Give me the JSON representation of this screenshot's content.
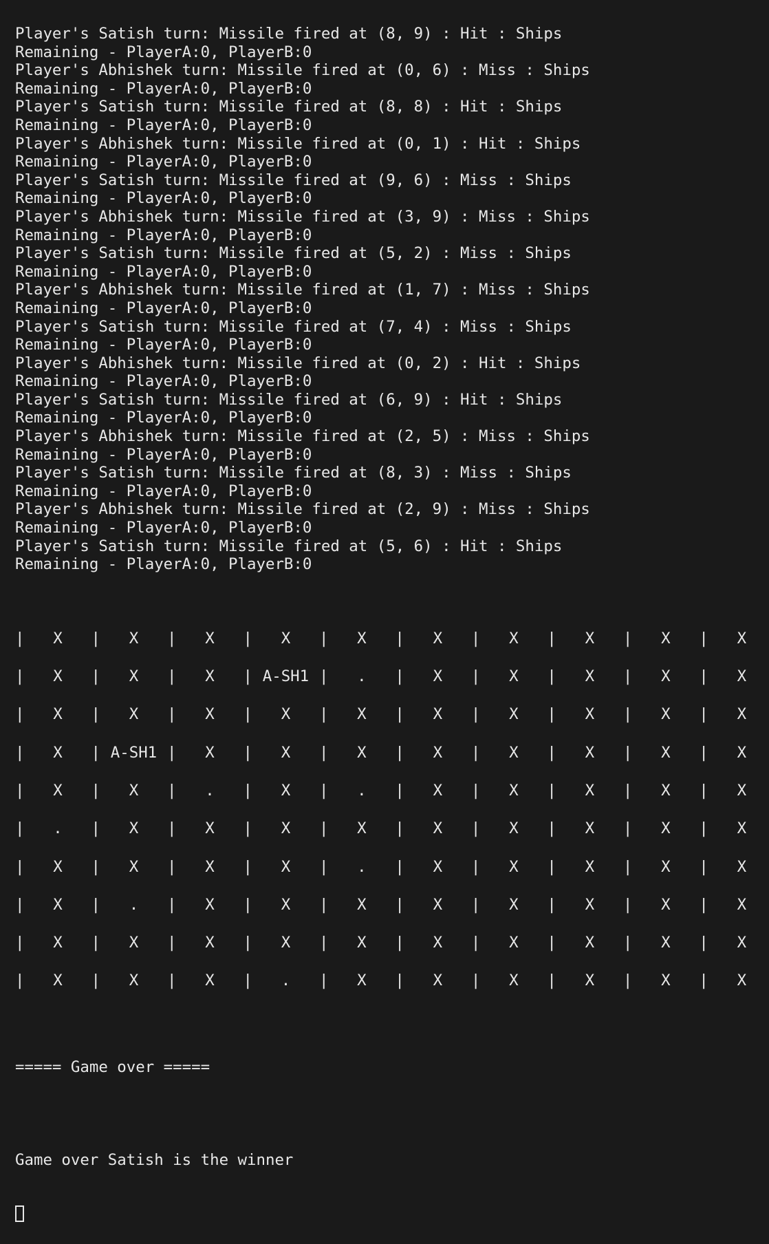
{
  "terminal": {
    "log_lines": [
      "Player's Satish turn: Missile fired at (8, 9) : Hit : Ships",
      "Remaining - PlayerA:0, PlayerB:0",
      "Player's Abhishek turn: Missile fired at (0, 6) : Miss : Ships",
      "Remaining - PlayerA:0, PlayerB:0",
      "Player's Satish turn: Missile fired at (8, 8) : Hit : Ships",
      "Remaining - PlayerA:0, PlayerB:0",
      "Player's Abhishek turn: Missile fired at (0, 1) : Hit : Ships",
      "Remaining - PlayerA:0, PlayerB:0",
      "Player's Satish turn: Missile fired at (9, 6) : Miss : Ships",
      "Remaining - PlayerA:0, PlayerB:0",
      "Player's Abhishek turn: Missile fired at (3, 9) : Miss : Ships",
      "Remaining - PlayerA:0, PlayerB:0",
      "Player's Satish turn: Missile fired at (5, 2) : Miss : Ships",
      "Remaining - PlayerA:0, PlayerB:0",
      "Player's Abhishek turn: Missile fired at (1, 7) : Miss : Ships",
      "Remaining - PlayerA:0, PlayerB:0",
      "Player's Satish turn: Missile fired at (7, 4) : Miss : Ships",
      "Remaining - PlayerA:0, PlayerB:0",
      "Player's Abhishek turn: Missile fired at (0, 2) : Hit : Ships",
      "Remaining - PlayerA:0, PlayerB:0",
      "Player's Satish turn: Missile fired at (6, 9) : Hit : Ships",
      "Remaining - PlayerA:0, PlayerB:0",
      "Player's Abhishek turn: Missile fired at (2, 5) : Miss : Ships",
      "Remaining - PlayerA:0, PlayerB:0",
      "Player's Satish turn: Missile fired at (8, 3) : Miss : Ships",
      "Remaining - PlayerA:0, PlayerB:0",
      "Player's Abhishek turn: Missile fired at (2, 9) : Miss : Ships",
      "Remaining - PlayerA:0, PlayerB:0",
      "Player's Satish turn: Missile fired at (5, 6) : Hit : Ships",
      "Remaining - PlayerA:0, PlayerB:0"
    ],
    "board": [
      [
        "X",
        "X",
        "X",
        "X",
        "X",
        "X",
        "X",
        "X",
        "X",
        "X"
      ],
      [
        "X",
        "X",
        "X",
        "A-SH1",
        ".",
        "X",
        "X",
        "X",
        "X",
        "X"
      ],
      [
        "X",
        "X",
        "X",
        "X",
        "X",
        "X",
        "X",
        "X",
        "X",
        "X"
      ],
      [
        "X",
        "A-SH1",
        "X",
        "X",
        "X",
        "X",
        "X",
        "X",
        "X",
        "X"
      ],
      [
        "X",
        "X",
        ".",
        "X",
        ".",
        "X",
        "X",
        "X",
        "X",
        "X"
      ],
      [
        ".",
        "X",
        "X",
        "X",
        "X",
        "X",
        "X",
        "X",
        "X",
        "X"
      ],
      [
        "X",
        "X",
        "X",
        "X",
        ".",
        "X",
        "X",
        "X",
        "X",
        "X"
      ],
      [
        "X",
        ".",
        "X",
        "X",
        "X",
        "X",
        "X",
        "X",
        "X",
        "X"
      ],
      [
        "X",
        "X",
        "X",
        "X",
        "X",
        "X",
        "X",
        "X",
        "X",
        "X"
      ],
      [
        "X",
        "X",
        "X",
        ".",
        "X",
        "X",
        "X",
        "X",
        "X",
        "X"
      ]
    ],
    "cell_separator": "|",
    "game_over_banner": "===== Game over =====",
    "winner_message": "Game over Satish is the winner"
  }
}
